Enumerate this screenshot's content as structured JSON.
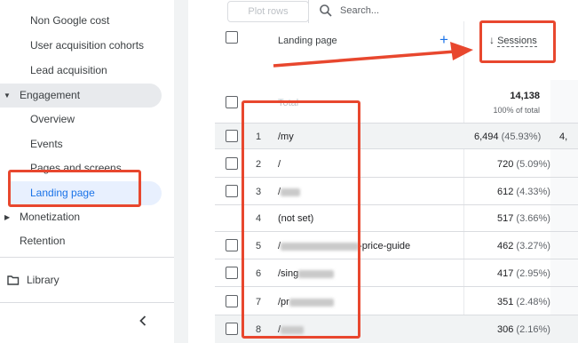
{
  "sidebar": {
    "items": [
      {
        "label": "Non Google cost"
      },
      {
        "label": "User acquisition cohorts"
      },
      {
        "label": "Lead acquisition"
      },
      {
        "label": "Engagement"
      },
      {
        "label": "Overview"
      },
      {
        "label": "Events"
      },
      {
        "label": "Pages and screens"
      },
      {
        "label": "Landing page"
      },
      {
        "label": "Monetization"
      },
      {
        "label": "Retention"
      },
      {
        "label": "Library"
      }
    ],
    "collapse_icon": "chevron-left-icon"
  },
  "toolbar": {
    "plot_rows_label": "Plot rows",
    "search_placeholder": "Search..."
  },
  "table": {
    "dimension_header": "Landing page",
    "metric_header": "Sessions",
    "total_label": "Total",
    "total_value": "14,138",
    "total_sub": "100% of total",
    "rows": [
      {
        "index": "1",
        "page": "/my",
        "value": "6,494",
        "pct": "(45.93%)",
        "next_col": "4,"
      },
      {
        "index": "2",
        "page": "/",
        "value": "720",
        "pct": "(5.09%)"
      },
      {
        "index": "3",
        "page": "/",
        "value": "612",
        "pct": "(4.33%)"
      },
      {
        "index": "4",
        "page": "(not set)",
        "value": "517",
        "pct": "(3.66%)"
      },
      {
        "index": "5",
        "page": "/",
        "page_suffix": "-price-guide",
        "value": "462",
        "pct": "(3.27%)"
      },
      {
        "index": "6",
        "page": "/sing",
        "value": "417",
        "pct": "(2.95%)"
      },
      {
        "index": "7",
        "page": "/pr",
        "value": "351",
        "pct": "(2.48%)"
      },
      {
        "index": "8",
        "page": "/",
        "value": "306",
        "pct": "(2.16%)"
      }
    ]
  },
  "colors": {
    "annotation": "#e8472e",
    "accent": "#1a73e8"
  }
}
